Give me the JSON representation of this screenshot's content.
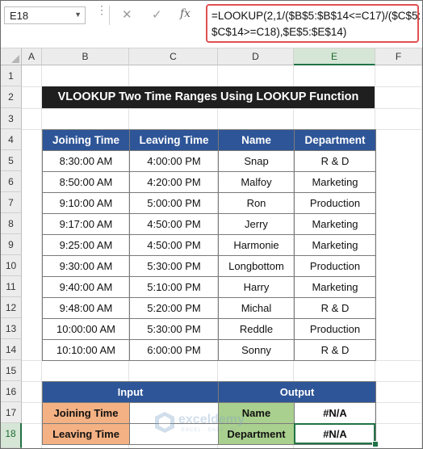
{
  "name_box": {
    "value": "E18",
    "dropdown_icon": "chevron-down-icon"
  },
  "formula_bar": {
    "cancel_icon": "✕",
    "enter_icon": "✓",
    "fx_label": "fx",
    "formula_line1": "=LOOKUP(2,1/($B$5:$B$14<=C17)/($C$5:",
    "formula_line2": "$C$14>=C18),$E$5:$E$14)"
  },
  "columns": [
    "A",
    "B",
    "C",
    "D",
    "E",
    "F"
  ],
  "rows": [
    "1",
    "2",
    "3",
    "4",
    "5",
    "6",
    "7",
    "8",
    "9",
    "10",
    "11",
    "12",
    "13",
    "14",
    "15",
    "16",
    "17",
    "18"
  ],
  "title": "VLOOKUP Two Time Ranges Using LOOKUP Function",
  "table": {
    "headers": [
      "Joining Time",
      "Leaving Time",
      "Name",
      "Department"
    ],
    "rows": [
      [
        "8:30:00 AM",
        "4:00:00 PM",
        "Snap",
        "R & D"
      ],
      [
        "8:50:00 AM",
        "4:20:00 PM",
        "Malfoy",
        "Marketing"
      ],
      [
        "9:10:00 AM",
        "5:00:00 PM",
        "Ron",
        "Production"
      ],
      [
        "9:17:00 AM",
        "4:50:00 PM",
        "Jerry",
        "Marketing"
      ],
      [
        "9:25:00 AM",
        "4:50:00 PM",
        "Harmonie",
        "Marketing"
      ],
      [
        "9:30:00 AM",
        "5:30:00 PM",
        "Longbottom",
        "Production"
      ],
      [
        "9:40:00 AM",
        "5:10:00 PM",
        "Harry",
        "Marketing"
      ],
      [
        "9:48:00 AM",
        "5:20:00 PM",
        "Michal",
        "R & D"
      ],
      [
        "10:00:00 AM",
        "5:30:00 PM",
        "Reddle",
        "Production"
      ],
      [
        "10:10:00 AM",
        "6:00:00 PM",
        "Sonny",
        "R & D"
      ]
    ]
  },
  "io": {
    "input_header": "Input",
    "output_header": "Output",
    "joining_label": "Joining Time",
    "leaving_label": "Leaving Time",
    "joining_value": "",
    "leaving_value": "",
    "name_label": "Name",
    "department_label": "Department",
    "name_result": "#N/A",
    "department_result": "#N/A"
  },
  "watermark": {
    "text": "exceldemy",
    "sub": "EXCEL · DATA · BI"
  },
  "colors": {
    "header_blue": "#2e5597",
    "orange": "#f4b183",
    "green": "#a9d08e",
    "title_black": "#1f1f1f",
    "select_green": "#217346"
  }
}
